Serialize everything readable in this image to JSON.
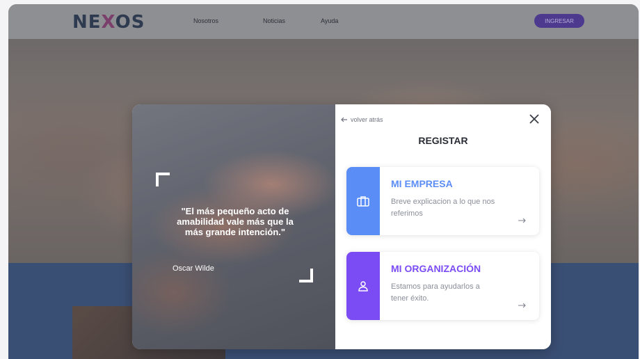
{
  "nav": {
    "logo_left": "NE",
    "logo_x": "X",
    "logo_right": "OS",
    "links": [
      "Nosotros",
      "Noticias",
      "Ayuda"
    ],
    "login_label": "INGRESAR"
  },
  "modal": {
    "quote": "\"El más pequeño acto de amabilidad vale más que la más grande intención.\"",
    "author": "Oscar Wilde",
    "back_label": "volver atrás",
    "close_label": "✕",
    "title": "REGISTAR",
    "options": [
      {
        "title": "MI EMPRESA",
        "description": "Breve explicacion a lo que nos referimos",
        "icon": "briefcase-icon",
        "color": "#5b8df7"
      },
      {
        "title": "MI ORGANIZACIÓN",
        "description": "Estamos para ayudarlos a tener éxito.",
        "icon": "user-icon",
        "color": "#7b4cf4"
      }
    ]
  },
  "colors": {
    "accent_blue": "#5b8df7",
    "accent_purple": "#7b4cf4",
    "brand_button": "#4d3a8e",
    "lower_section": "#3a4f74"
  }
}
